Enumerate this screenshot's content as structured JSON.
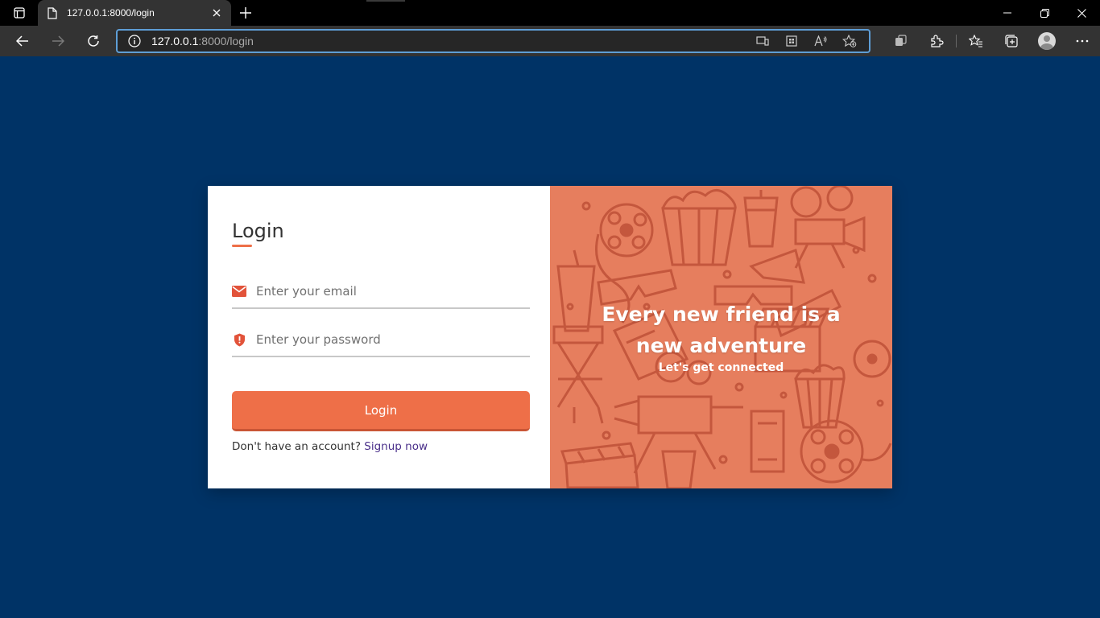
{
  "browser": {
    "tab_title": "127.0.0.1:8000/login",
    "url_host": "127.0.0.1",
    "url_rest": ":8000/login",
    "icons": [
      "tab-actions-icon",
      "page-icon",
      "close-icon",
      "plus-icon",
      "minimize-icon",
      "restore-icon",
      "close-window-icon",
      "back-icon",
      "forward-icon",
      "refresh-icon",
      "info-icon",
      "immersive-reader-icon",
      "apps-icon",
      "read-aloud-icon",
      "add-favorite-icon",
      "copilot-icon",
      "extensions-icon",
      "favorites-icon",
      "collections-icon",
      "profile-icon",
      "more-icon"
    ]
  },
  "page": {
    "background": "#003366",
    "accent": "#ee6f48",
    "login": {
      "title": "Login",
      "email_placeholder": "Enter your email",
      "password_placeholder": "Enter your password",
      "button_label": "Login",
      "no_account_text": "Don't have an account?",
      "signup_link": "Signup now"
    },
    "promo": {
      "title": "Every new friend is a new adventure",
      "subtitle": "Let's get connected",
      "background": "#e67e5e"
    }
  }
}
